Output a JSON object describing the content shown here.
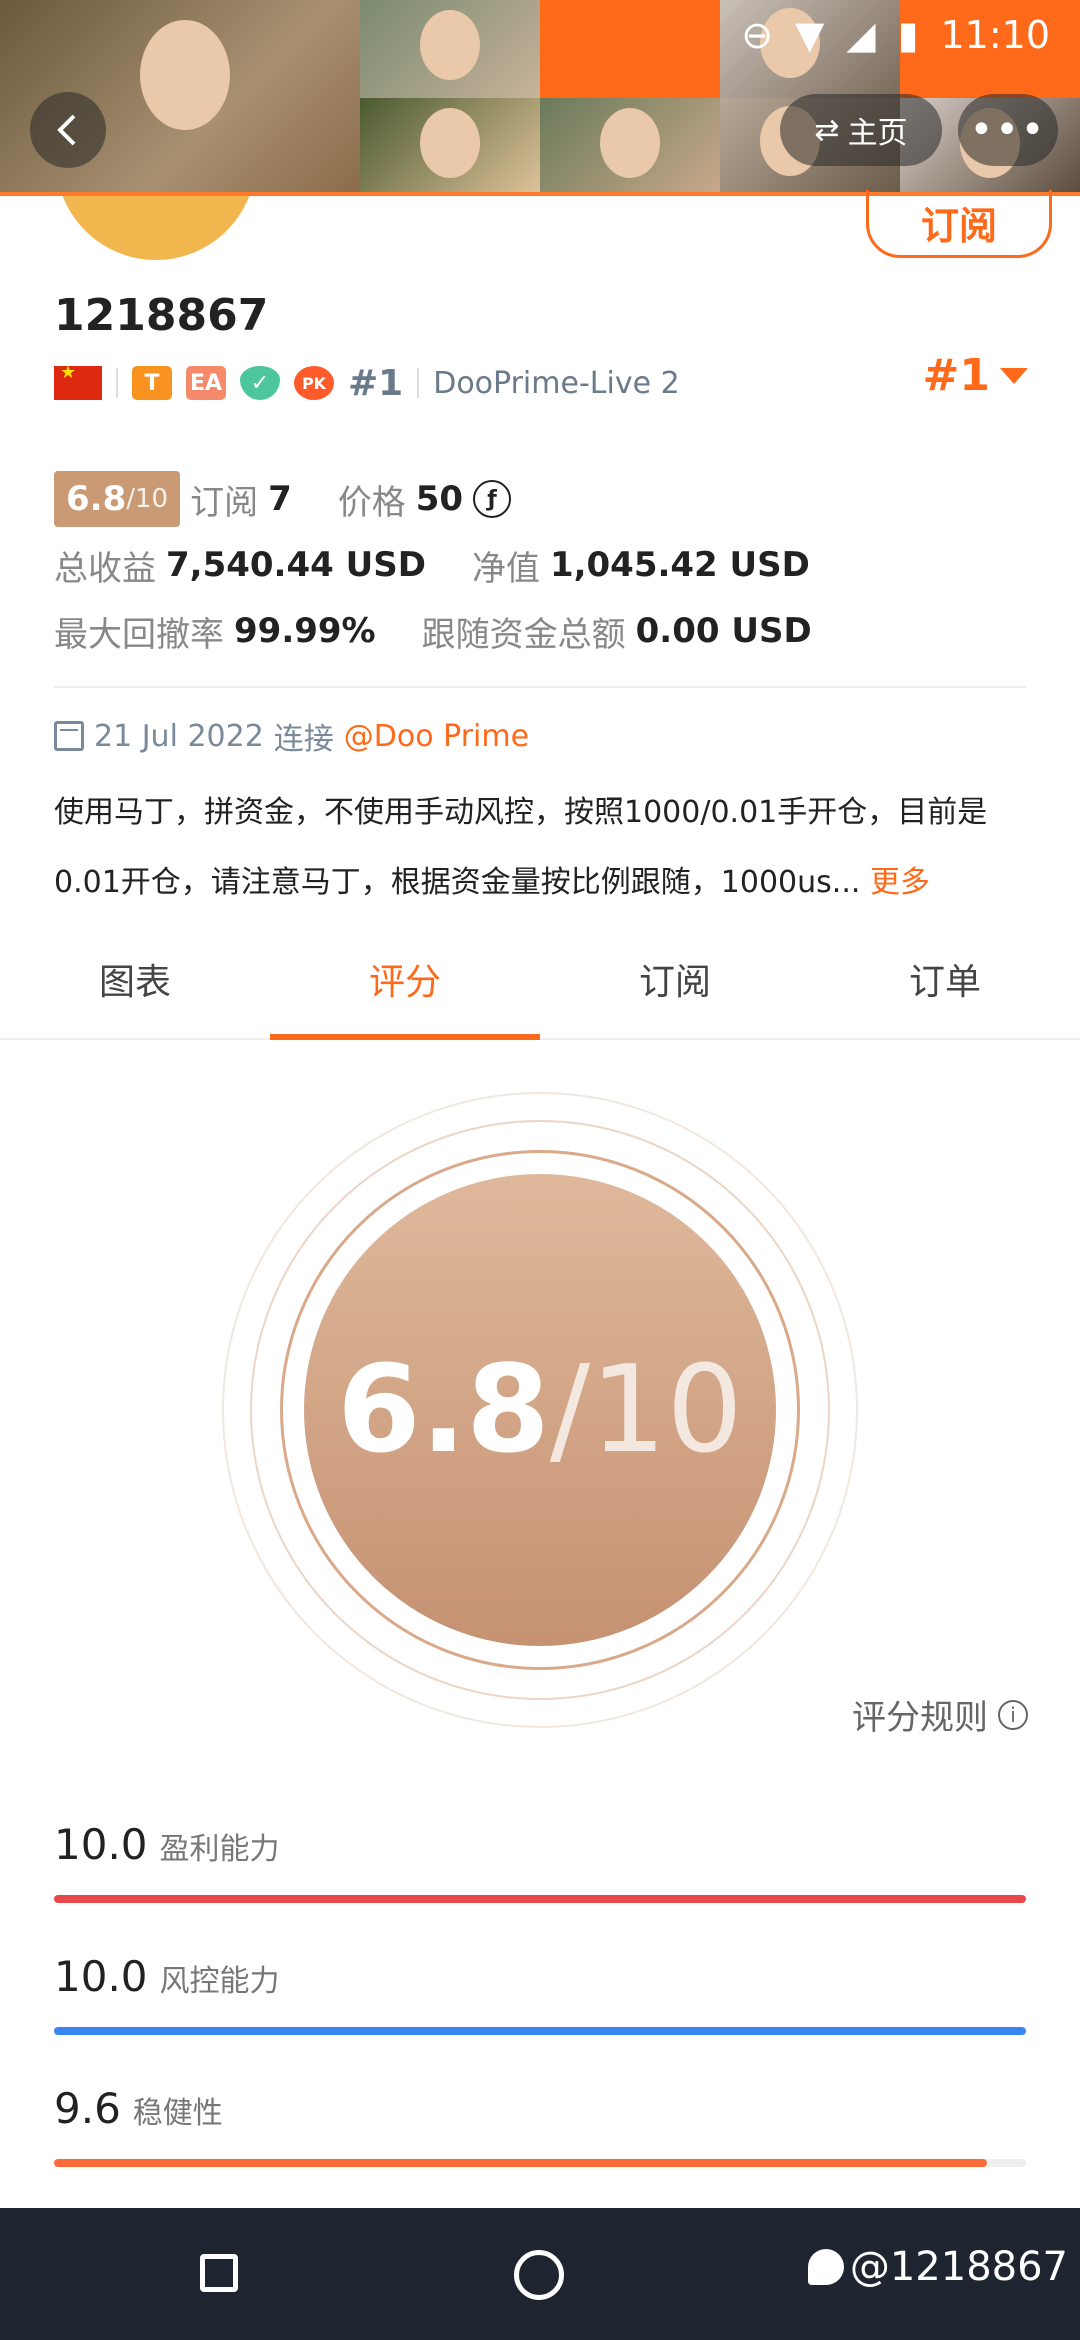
{
  "status_bar": {
    "time": "11:10"
  },
  "header": {
    "home_label": "主页"
  },
  "profile": {
    "subscribe_label": "订阅",
    "name": "1218867",
    "rank_badge": "#1",
    "server": "DooPrime-Live 2",
    "rank_right": "#1",
    "badges": {
      "t": "T",
      "ea": "EA",
      "pk": "PK"
    }
  },
  "stats": {
    "score": "6.8",
    "score_max": "/10",
    "subscribe_label": "订阅",
    "subscribe_count": "7",
    "price_label": "价格",
    "price_value": "50",
    "total_profit_label": "总收益",
    "total_profit_value": "7,540.44 USD",
    "net_label": "净值",
    "net_value": "1,045.42 USD",
    "drawdown_label": "最大回撤率",
    "drawdown_value": "99.99%",
    "follow_label": "跟随资金总额",
    "follow_value": "0.00 USD"
  },
  "connection": {
    "date": "21 Jul 2022",
    "verb": "连接",
    "broker": "@Doo Prime"
  },
  "description": {
    "text": "使用马丁，拼资金，不使用手动风控，按照1000/0.01手开仓，目前是0.01开仓，请注意马丁，根据资金量按比例跟随，1000us...",
    "more": "更多"
  },
  "tabs": [
    {
      "label": "图表"
    },
    {
      "label": "评分"
    },
    {
      "label": "订阅"
    },
    {
      "label": "订单"
    }
  ],
  "score_ring": {
    "value": "6.8",
    "max": "/10"
  },
  "rules_label": "评分规则",
  "metrics": [
    {
      "value": "10.0",
      "label": "盈利能力",
      "fraction": 1.0,
      "color": "#e8484a"
    },
    {
      "value": "10.0",
      "label": "风控能力",
      "fraction": 1.0,
      "color": "#3a86f0"
    },
    {
      "value": "9.6",
      "label": "稳健性",
      "fraction": 0.96,
      "color": "#ff6a3a"
    }
  ],
  "watermark": "@1218867"
}
